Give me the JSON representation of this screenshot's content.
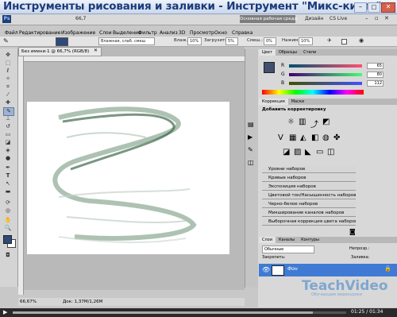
{
  "title": "Инструменты рисования и заливки - Инструмент \"Микс-кисть\"",
  "ps_bar": {
    "logo": "Ps",
    "zoom": "66,7",
    "menus": [
      "Файл",
      "Редактирование",
      "Изображение",
      "Слои",
      "Выделение",
      "Фильтр",
      "Анализ",
      "3D",
      "Просмотр",
      "Окно",
      "Справка"
    ],
    "workspace_button": "Основная рабочая среда",
    "design_label": "Дизайн",
    "cs_live": "CS Live"
  },
  "options": {
    "brush_mode": "Влажная, слаб. смеш",
    "wet_label": "Влаж.:",
    "wet_value": "10%",
    "load_label": "Загрузить:",
    "load_value": "5%",
    "mix_label": "Смеш.:",
    "mix_value": "0%",
    "flow_label": "Нажим:",
    "flow_value": "10%"
  },
  "document": {
    "tab": "Без имени-1 @ 66,7% (RGB/8)",
    "zoom_status": "66,67%",
    "doc_status": "Док: 1,37М/1,26М"
  },
  "color_panel": {
    "tabs": [
      "Цвет",
      "Образцы",
      "Стили"
    ],
    "r_label": "R",
    "g_label": "G",
    "b_label": "B",
    "r": "65",
    "g": "80",
    "b": "112",
    "foreground": "#415070"
  },
  "adjust_panel": {
    "tabs": [
      "Коррекция",
      "Маски"
    ],
    "header": "Добавить корректировку",
    "presets": [
      "Уровни наборов",
      "Кривые наборов",
      "Экспозиция наборов",
      "Цветовой тон/Насыщенность наборов",
      "Черно-белое наборов",
      "Микширование каналов наборов",
      "Выборочная коррекция цвета наборов"
    ]
  },
  "layers_panel": {
    "tabs": [
      "Слои",
      "Каналы",
      "Контуры"
    ],
    "blend": "Обычные",
    "lock_label": "Закрепить:",
    "opacity_label": "Непрозр.:",
    "fill_label": "Заливка:",
    "layer_name": "Фон"
  },
  "watermark": {
    "brand": "TeachVideo",
    "tagline": "Обучающие видеоуроки"
  },
  "player": {
    "time": "01:25 / 01:34",
    "progress": 0.9
  }
}
